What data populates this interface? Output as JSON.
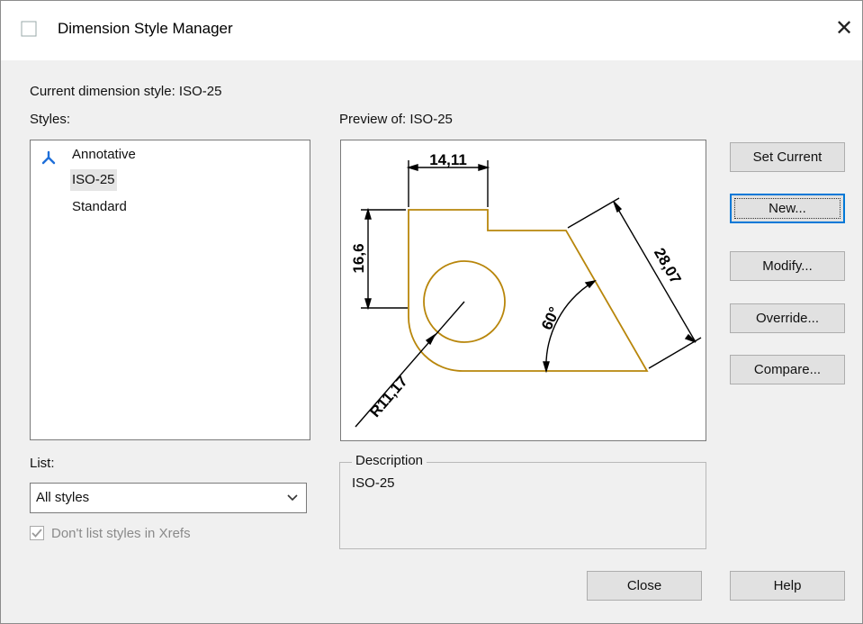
{
  "window": {
    "title": "Dimension Style Manager",
    "close_glyph": "✕"
  },
  "current_style": "Current dimension style: ISO-25",
  "styles_label": "Styles:",
  "styles": [
    {
      "name": "Annotative",
      "icon": "annotative-icon"
    },
    {
      "name": "ISO-25",
      "selected": true
    },
    {
      "name": "Standard"
    }
  ],
  "preview_label": "Preview of: ISO-25",
  "preview": {
    "dim_top": "14,11",
    "dim_left": "16,6",
    "dim_slant": "28,07",
    "dim_angle": "60°",
    "dim_radius": "R11,17",
    "colors": {
      "geometry": "#b8860b",
      "dimension": "#000000"
    }
  },
  "buttons": {
    "set_current": "Set Current",
    "new": "New...",
    "modify": "Modify...",
    "override": "Override...",
    "compare": "Compare...",
    "close": "Close",
    "help": "Help"
  },
  "list_label": "List:",
  "list_value": "All styles",
  "xrefs_label": "Don't list styles in Xrefs",
  "xrefs_checked": true,
  "description": {
    "legend": "Description",
    "text": "ISO-25"
  }
}
